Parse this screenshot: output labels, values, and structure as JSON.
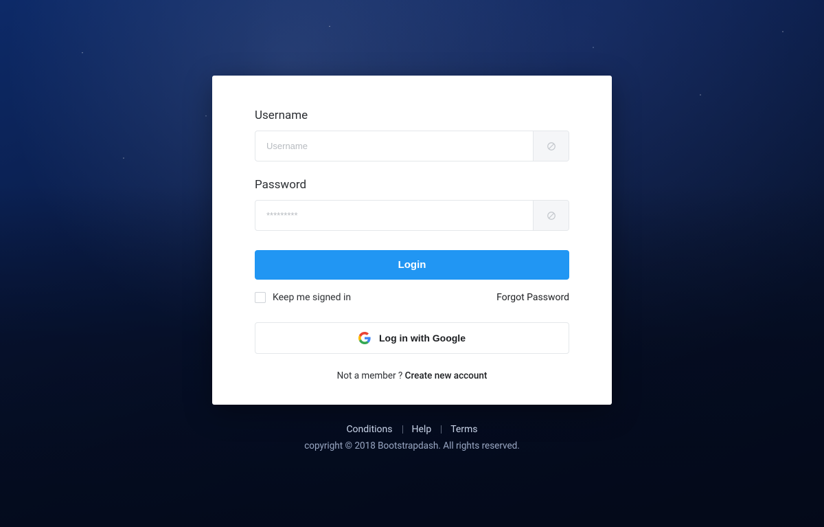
{
  "form": {
    "username": {
      "label": "Username",
      "placeholder": "Username",
      "value": ""
    },
    "password": {
      "label": "Password",
      "placeholder": "*********",
      "value": ""
    },
    "login_button": "Login",
    "keep_signed_in": "Keep me signed in",
    "forgot_password": "Forgot Password",
    "google_button": "Log in with Google",
    "signup_prompt": "Not a member ? ",
    "signup_link": "Create new account"
  },
  "footer": {
    "links": {
      "conditions": "Conditions",
      "help": "Help",
      "terms": "Terms"
    },
    "copyright": "copyright © 2018 Bootstrapdash. All rights reserved."
  }
}
